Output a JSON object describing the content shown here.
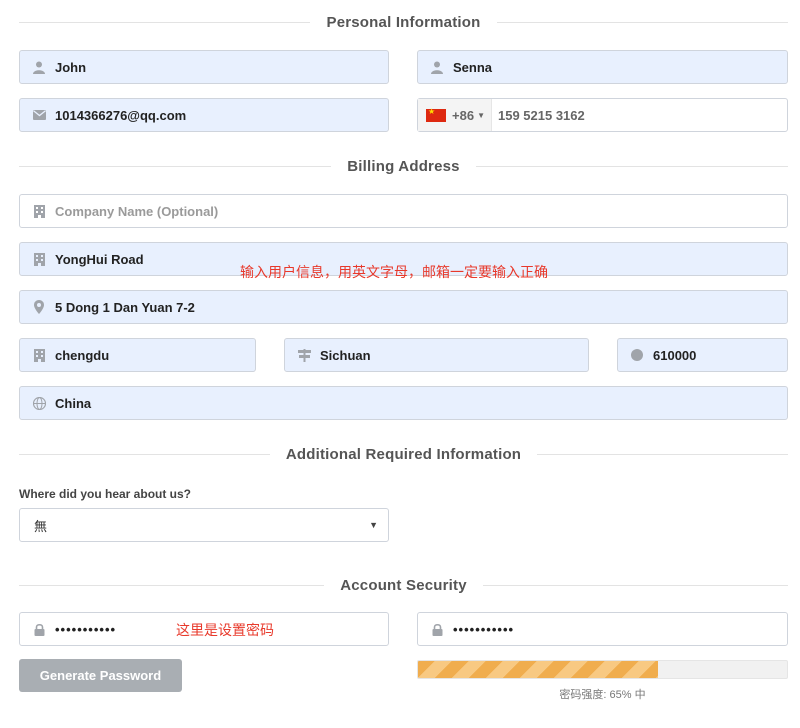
{
  "sections": {
    "personal": "Personal Information",
    "billing": "Billing Address",
    "additional": "Additional Required Information",
    "security": "Account Security"
  },
  "personal": {
    "first_name": "John",
    "last_name": "Senna",
    "email": "1014366276@qq.com",
    "phone_country_code": "+86",
    "phone_number": "159 5215 3162"
  },
  "billing": {
    "company_placeholder": "Company Name (Optional)",
    "address1": "YongHui Road",
    "address2": "5 Dong 1 Dan Yuan 7-2",
    "city": "chengdu",
    "state": "Sichuan",
    "postcode": "610000",
    "country": "China"
  },
  "annotations": {
    "user_info_note": "输入用户信息，用英文字母，邮箱一定要输入正确",
    "password_note": "这里是设置密码"
  },
  "additional": {
    "question": "Where did you hear about us?",
    "selected": "無"
  },
  "security": {
    "password": "•••••••••••",
    "confirm_password": "•••••••••••",
    "generate_label": "Generate Password",
    "strength_fraction": 0.65,
    "strength_text": "密码强度: 65% 中"
  },
  "colors": {
    "autofill_bg": "#e8f0fe",
    "meter_fill": "#f0ad4e",
    "note_red": "#e8392b",
    "button_gray": "#a9aeb3"
  },
  "icons": {
    "name": "user-icon",
    "email": "envelope-icon",
    "company": "building-icon",
    "map": "map-marker-icon",
    "state": "map-sign-icon",
    "postcode": "circle-icon",
    "country": "globe-icon",
    "password": "lock-icon"
  }
}
